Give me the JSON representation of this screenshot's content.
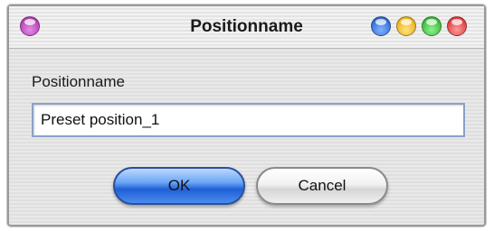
{
  "window": {
    "title": "Positionname",
    "controls": [
      "purple-orb",
      "blue-orb",
      "yellow-orb",
      "green-orb",
      "red-orb"
    ]
  },
  "form": {
    "label": "Positionname",
    "input_value": "Preset position_1"
  },
  "buttons": {
    "ok_label": "OK",
    "cancel_label": "Cancel"
  },
  "colors": {
    "ok_button": "#1f5fd6",
    "input_border": "#8aa0c8"
  }
}
